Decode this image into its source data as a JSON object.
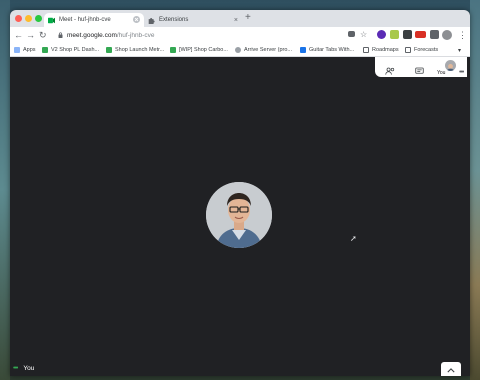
{
  "browser": {
    "tabs": [
      {
        "label": "Meet - huf-jhnb-cve",
        "active": true
      },
      {
        "label": "Extensions",
        "active": false
      }
    ],
    "url": {
      "host": "meet.google.com",
      "path": "/huf-jhnb-cve"
    }
  },
  "bookmarks": [
    {
      "label": "Apps"
    },
    {
      "label": "V2 Shop PL Dash..."
    },
    {
      "label": "Shop Launch Metr..."
    },
    {
      "label": "[WIP] Shop Carbo..."
    },
    {
      "label": "Arrive Server (pro..."
    },
    {
      "label": "Guitar Tabs With..."
    },
    {
      "label": "Roadmaps"
    },
    {
      "label": "Forecasts"
    }
  ],
  "meet": {
    "self_label": "You",
    "avatar_label": "You",
    "icons": [
      "people-icon",
      "chat-icon",
      "more-icon",
      "chevron-up-icon"
    ]
  },
  "colors": {
    "meet_background": "#202124",
    "tabstrip": "#dee1e6",
    "close_light": "#ff5f57",
    "min_light": "#febc2e",
    "max_light": "#28c840"
  }
}
